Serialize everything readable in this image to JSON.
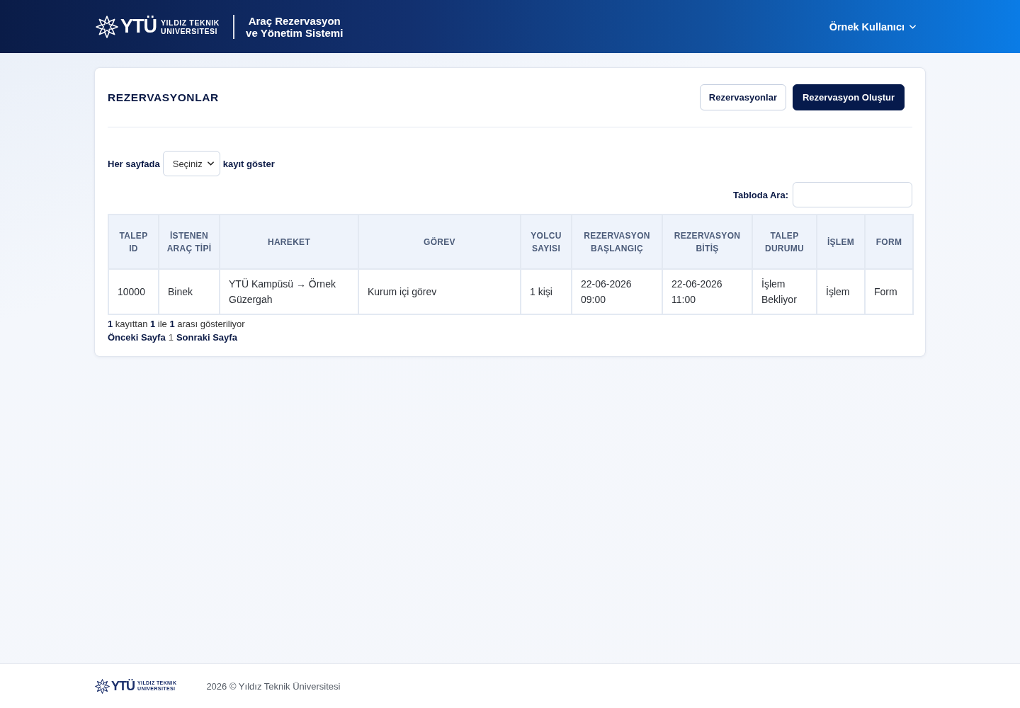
{
  "header": {
    "logo": {
      "mark": "YTÜ",
      "lines": [
        "YILDIZ TEKNIK",
        "UNIVERSITESI"
      ]
    },
    "app_title": [
      "Araç Rezervasyon",
      "ve Yönetim Sistemi"
    ],
    "user_menu": {
      "label": "Örnek Kullanıcı"
    }
  },
  "page": {
    "title": "REZERVASYONLAR",
    "buttons": [
      {
        "label": "Rezervasyonlar",
        "kind": "outline"
      },
      {
        "label": "Rezervasyon Oluştur",
        "kind": "primary"
      }
    ],
    "page_length": {
      "label_before": "Her sayfada",
      "value": "Seçiniz",
      "label_after": "kayıt göster"
    },
    "search": {
      "label": "Tabloda Ara:"
    },
    "table": {
      "columns": [
        "TALEP ID",
        "İSTENEN ARAÇ TİPİ",
        "HAREKET",
        "GÖREV",
        "YOLCU SAYISI",
        "REZERVASYON BAŞLANGIÇ",
        "REZERVASYON BİTİŞ",
        "TALEP DURUMU",
        "İŞLEM",
        "FORM"
      ],
      "rows": [
        [
          "10000",
          "Binek",
          "YTÜ Kampüsü → Örnek Güzergah",
          "Kurum içi görev",
          "1 kişi",
          "22-06-2026 09:00",
          "22-06-2026 11:00",
          "İşlem Bekliyor",
          "İşlem",
          "Form"
        ]
      ]
    },
    "info": "**1** kayıttan **1** ile **1** arası gösteriliyor",
    "pagination": {
      "previous": "Önceki Sayfa",
      "pages": [
        {
          "label": "1",
          "selected": true
        }
      ],
      "next": "Sonraki Sayfa"
    }
  },
  "footer": {
    "logo": {
      "mark": "YTÜ",
      "lines": [
        "YILDIZ TEKNIK",
        "UNIVERSITESI"
      ]
    },
    "copyright": "2026 © Yıldız Teknik Üniversitesi"
  }
}
